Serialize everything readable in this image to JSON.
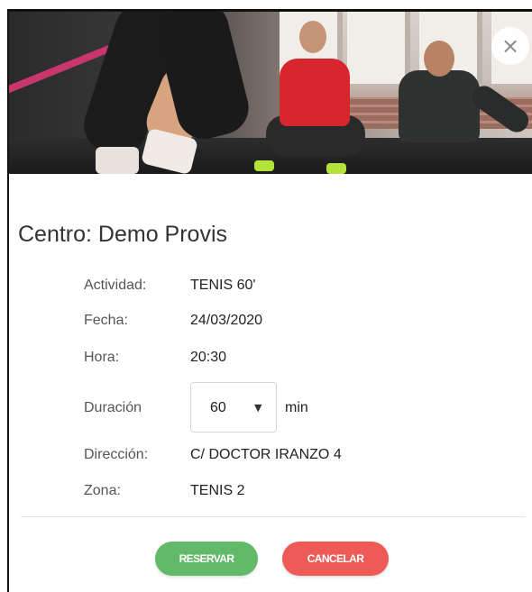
{
  "modal": {
    "close_glyph": "×",
    "title": "Centro: Demo Provis"
  },
  "details": {
    "actividad": {
      "label": "Actividad:",
      "value": "TENIS 60'"
    },
    "fecha": {
      "label": "Fecha:",
      "value": "24/03/2020"
    },
    "hora": {
      "label": "Hora:",
      "value": "20:30"
    },
    "duracion": {
      "label": "Duración",
      "selected": "60",
      "unit": "min"
    },
    "direccion": {
      "label": "Dirección:",
      "value": "C/ DOCTOR IRANZO 4"
    },
    "zona": {
      "label": "Zona:",
      "value": "TENIS 2"
    }
  },
  "actions": {
    "reservar_label": "RESERVAR",
    "cancelar_label": "CANCELAR"
  },
  "colors": {
    "reservar": "#62b967",
    "cancelar": "#ee5a55"
  },
  "icons": {
    "close": "close-icon",
    "select_caret": "caret-down-icon"
  }
}
